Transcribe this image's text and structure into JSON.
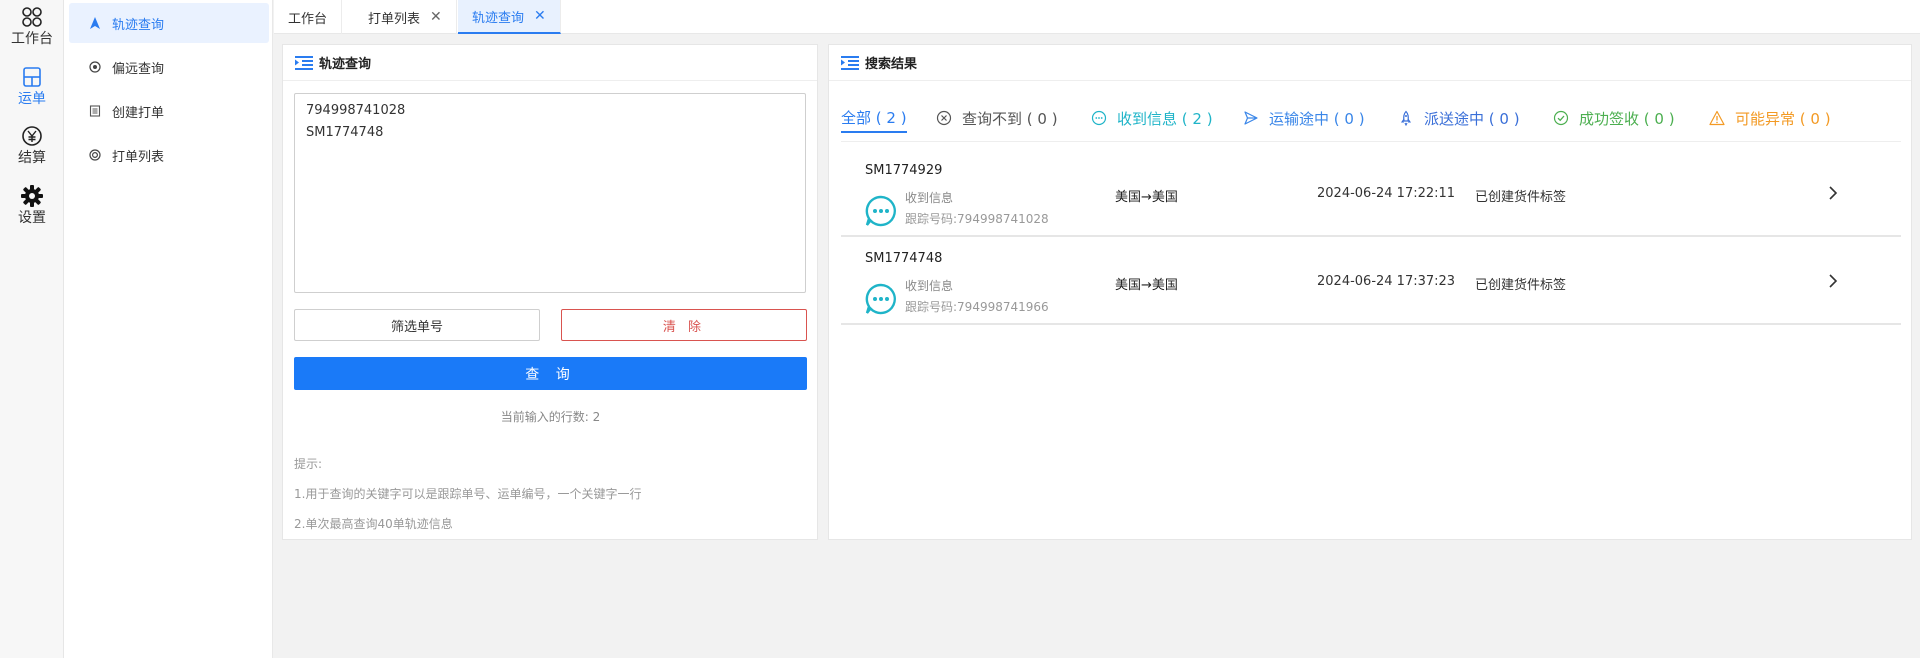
{
  "rail": [
    {
      "label": "工作台",
      "icon": "workbench-icon"
    },
    {
      "label": "运单",
      "icon": "waybill-icon"
    },
    {
      "label": "结算",
      "icon": "settlement-icon"
    },
    {
      "label": "设置",
      "icon": "gear-icon"
    }
  ],
  "submenu": [
    {
      "label": "轨迹查询"
    },
    {
      "label": "偏远查询"
    },
    {
      "label": "创建打单"
    },
    {
      "label": "打单列表"
    }
  ],
  "tabs": [
    {
      "label": "工作台"
    },
    {
      "label": "打单列表"
    },
    {
      "label": "轨迹查询"
    }
  ],
  "query_panel": {
    "title": "轨迹查询",
    "input_value": "794998741028\nSM1774748",
    "filter_button": "筛选单号",
    "clear_button": "清 除",
    "query_button": "查 询",
    "line_count": "当前输入的行数: 2",
    "tips_title": "提示:",
    "tip1": "1.用于查询的关键字可以是跟踪单号、运单编号，一个关键字一行",
    "tip2": "2.单次最高查询40单轨迹信息"
  },
  "results_panel": {
    "title": "搜索结果",
    "filters": [
      {
        "label": "全部 ( 2 )",
        "color": "#2a7cf0"
      },
      {
        "label": "查询不到 ( 0 )",
        "color": "#555555"
      },
      {
        "label": "收到信息 ( 2 )",
        "color": "#1fb4c8"
      },
      {
        "label": "运输途中 ( 0 )",
        "color": "#3a86e8"
      },
      {
        "label": "派送途中 ( 0 )",
        "color": "#3a6fd8"
      },
      {
        "label": "成功签收 ( 0 )",
        "color": "#4caf50"
      },
      {
        "label": "可能异常 ( 0 )",
        "color": "#f39a24"
      }
    ],
    "rows": [
      {
        "no": "SM1774929",
        "status": "收到信息",
        "track": "跟踪号码:794998741028",
        "route": "美国→美国",
        "time": "2024-06-24 17:22:11",
        "state": "已创建货件标签"
      },
      {
        "no": "SM1774748",
        "status": "收到信息",
        "track": "跟踪号码:794998741966",
        "route": "美国→美国",
        "time": "2024-06-24 17:37:23",
        "state": "已创建货件标签"
      }
    ]
  },
  "colors": {
    "accent": "#2a7cf0",
    "danger": "#d9534f",
    "info": "#1fb4c8"
  }
}
